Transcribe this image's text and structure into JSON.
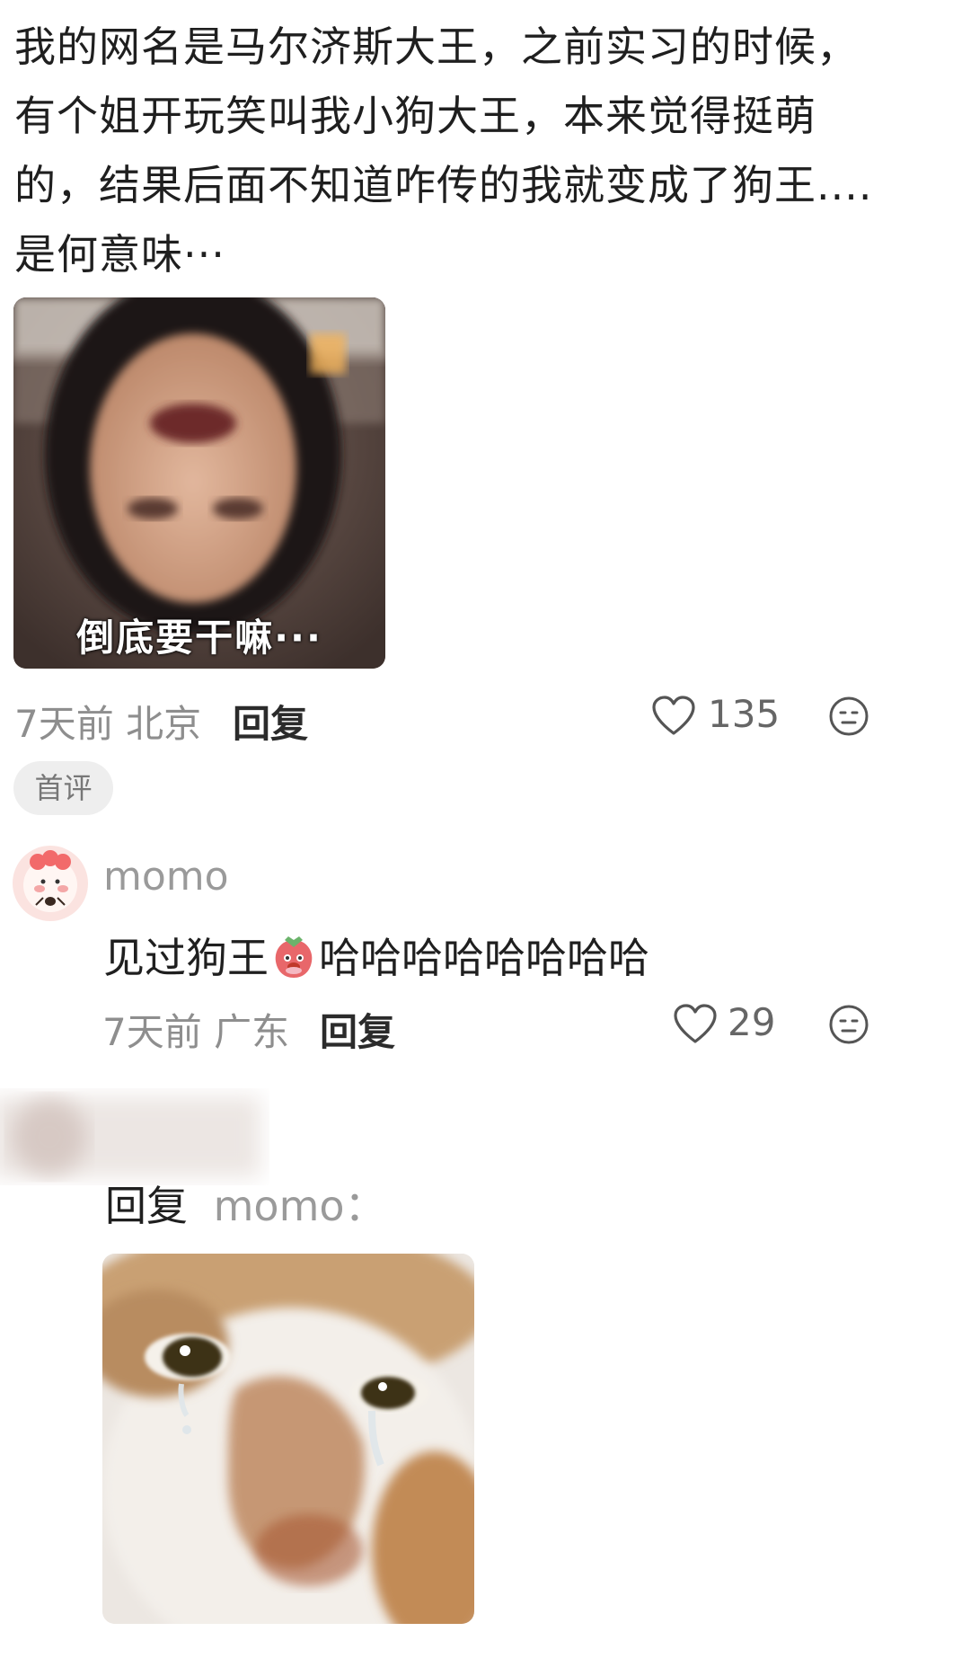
{
  "post": {
    "lines": [
      "我的网名是马尔济斯大王，之前实习的时候，",
      "有个姐开玩笑叫我小狗大王，本来觉得挺萌",
      "的，结果后面不知道咋传的我就变成了狗王....",
      "是何意味···"
    ],
    "image_caption": "倒底要干嘛···",
    "time_location": "7天前 北京",
    "reply_label": "回复",
    "like_count": "135",
    "badge": "首评"
  },
  "comment1": {
    "username": "momo",
    "text_before": "见过狗王",
    "text_after": "哈哈哈哈哈哈哈哈",
    "time_location": "7天前 广东",
    "reply_label": "回复",
    "like_count": "29"
  },
  "comment2": {
    "reply_prefix": "回复",
    "reply_to": "momo："
  },
  "colors": {
    "text": "#1f1f1f",
    "meta": "#8e8e8e",
    "badge_bg": "#eeeeee"
  }
}
